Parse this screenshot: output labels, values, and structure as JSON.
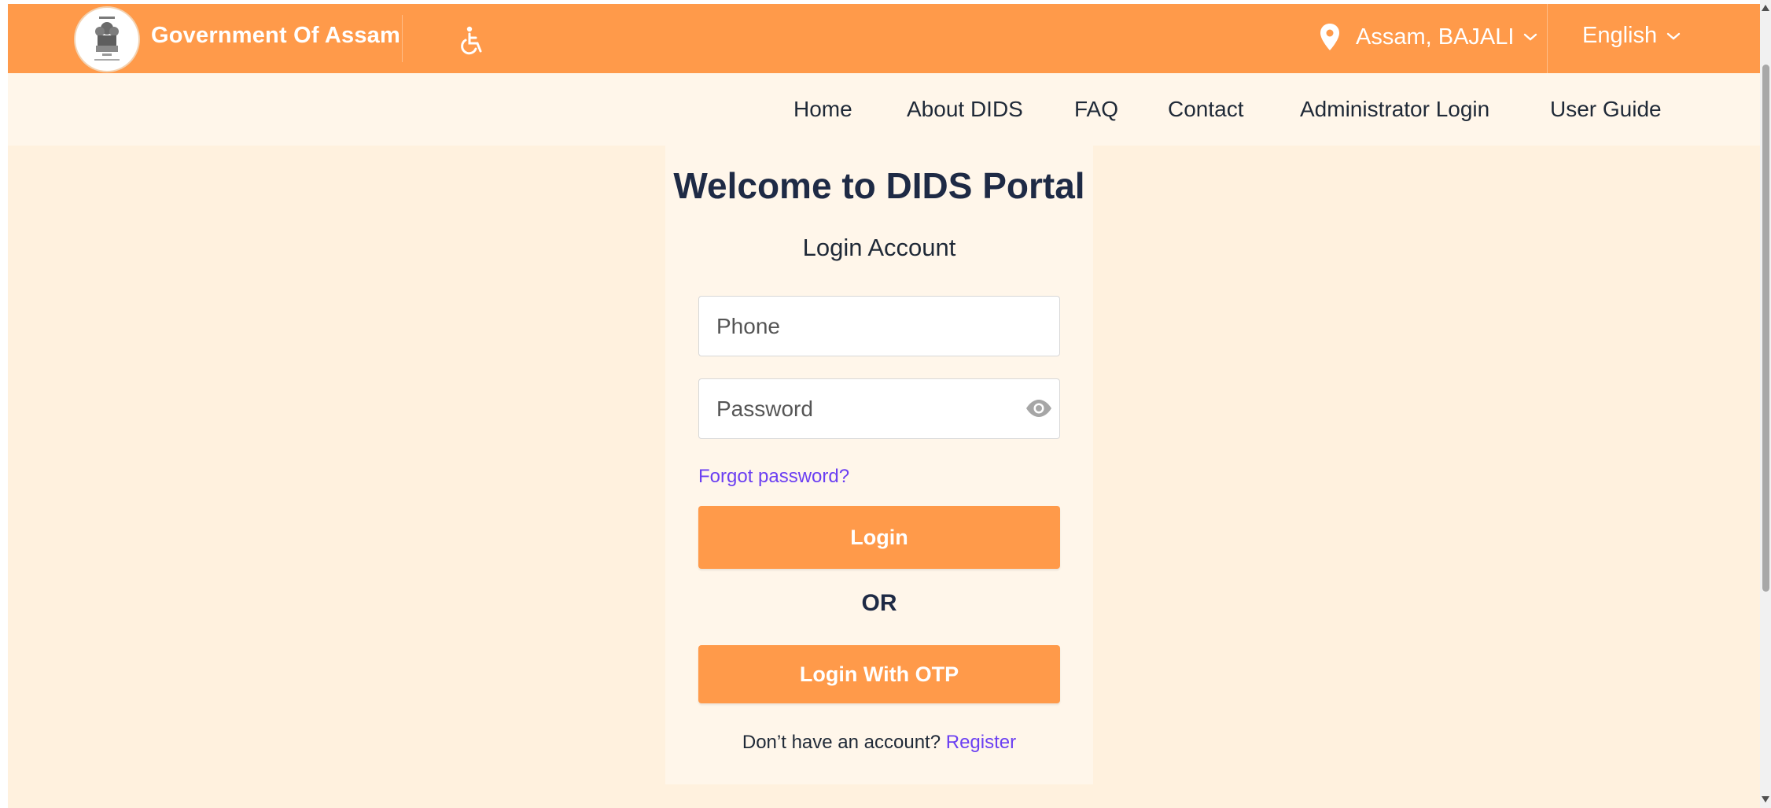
{
  "header": {
    "title": "Government Of Assam",
    "accessibility_icon": "wheelchair-icon",
    "location": "Assam, BAJALI",
    "language": "English"
  },
  "nav": {
    "items": [
      "Home",
      "About DIDS",
      "FAQ",
      "Contact",
      "Administrator Login",
      "User Guide"
    ]
  },
  "login": {
    "heading": "Welcome to DIDS Portal",
    "subtitle": "Login Account",
    "phone_placeholder": "Phone",
    "password_placeholder": "Password",
    "forgot": "Forgot password?",
    "login_button": "Login",
    "or": "OR",
    "otp_button": "Login With OTP",
    "no_account": "Don’t have an account?",
    "register": "Register"
  },
  "colors": {
    "accent": "#ff9a4a",
    "page_bg": "#fff1de",
    "nav_bg": "#fff6ea",
    "link": "#6b3ff2",
    "heading": "#1e2a45"
  }
}
